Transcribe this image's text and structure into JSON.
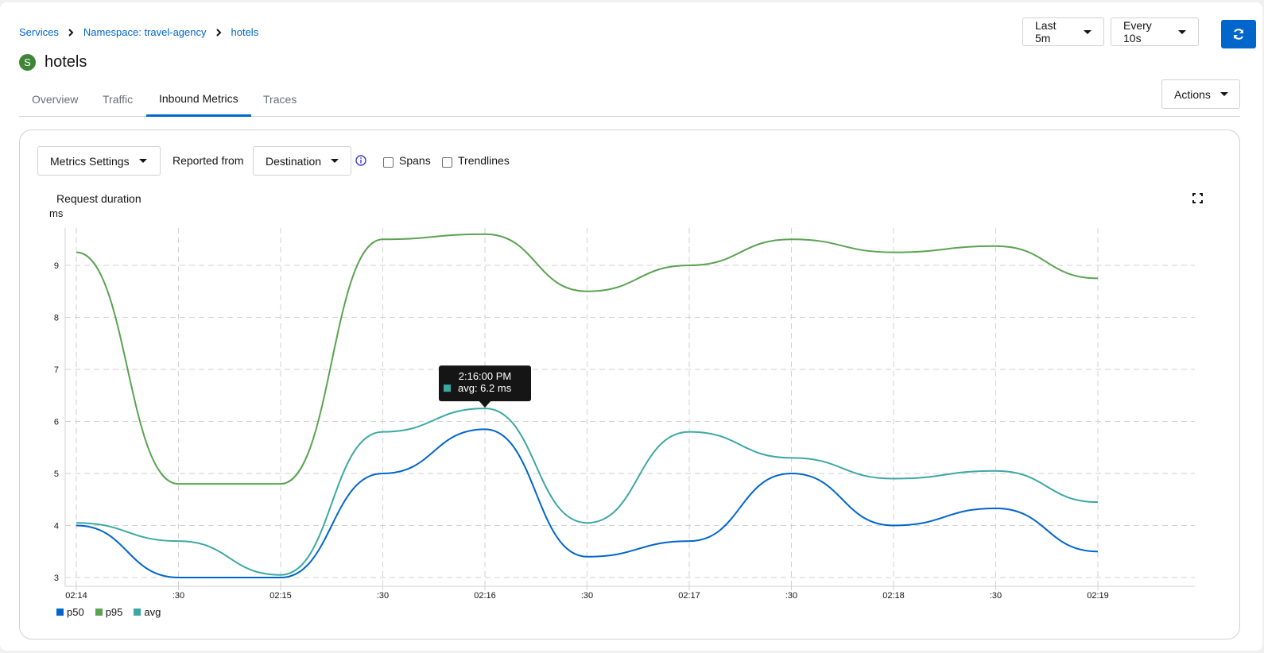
{
  "breadcrumb": {
    "services": "Services",
    "namespace": "Namespace: travel-agency",
    "current": "hotels"
  },
  "service": {
    "badge": "S",
    "name": "hotels"
  },
  "controls": {
    "time_range": "Last 5m",
    "refresh_interval": "Every 10s",
    "actions": "Actions"
  },
  "tabs": [
    {
      "label": "Overview"
    },
    {
      "label": "Traffic"
    },
    {
      "label": "Inbound Metrics"
    },
    {
      "label": "Traces"
    }
  ],
  "active_tab": "Inbound Metrics",
  "toolbar": {
    "metrics_settings": "Metrics Settings",
    "reported_from_label": "Reported from",
    "reported_from_value": "Destination",
    "spans_label": "Spans",
    "trendlines_label": "Trendlines"
  },
  "tooltip": {
    "time": "2:16:00 PM",
    "text": "avg: 6.2 ms"
  },
  "colors": {
    "accent": "#0066cc",
    "p50": "#0066cc",
    "p95": "#5ba352",
    "avg": "#3ca8a4",
    "badge": "#3e8635"
  },
  "chart_data": {
    "type": "line",
    "title": "Request duration",
    "ylabel": "ms",
    "ylim": [
      2.8,
      9.8
    ],
    "yticks": [
      3,
      4,
      5,
      6,
      7,
      8,
      9
    ],
    "x": [
      "02:14:00",
      "02:14:30",
      "02:15:00",
      "02:15:30",
      "02:16:00",
      "02:16:30",
      "02:17:00",
      "02:17:30",
      "02:18:00",
      "02:18:30",
      "02:19:00"
    ],
    "xticklabels": [
      "02:14",
      ":30",
      "02:15",
      ":30",
      "02:16",
      ":30",
      "02:17",
      ":30",
      "02:18",
      ":30",
      "02:19"
    ],
    "grid": true,
    "legend": "bottom-left",
    "series": [
      {
        "name": "p50",
        "values": [
          4.0,
          3.0,
          3.0,
          5.0,
          5.85,
          3.4,
          3.7,
          5.0,
          4.0,
          4.33,
          3.5
        ]
      },
      {
        "name": "p95",
        "values": [
          9.25,
          4.8,
          4.8,
          9.5,
          9.6,
          8.5,
          9.0,
          9.5,
          9.25,
          9.37,
          8.75
        ]
      },
      {
        "name": "avg",
        "values": [
          4.05,
          3.7,
          3.05,
          5.8,
          6.25,
          4.05,
          5.8,
          5.3,
          4.9,
          5.05,
          4.45
        ]
      }
    ]
  }
}
